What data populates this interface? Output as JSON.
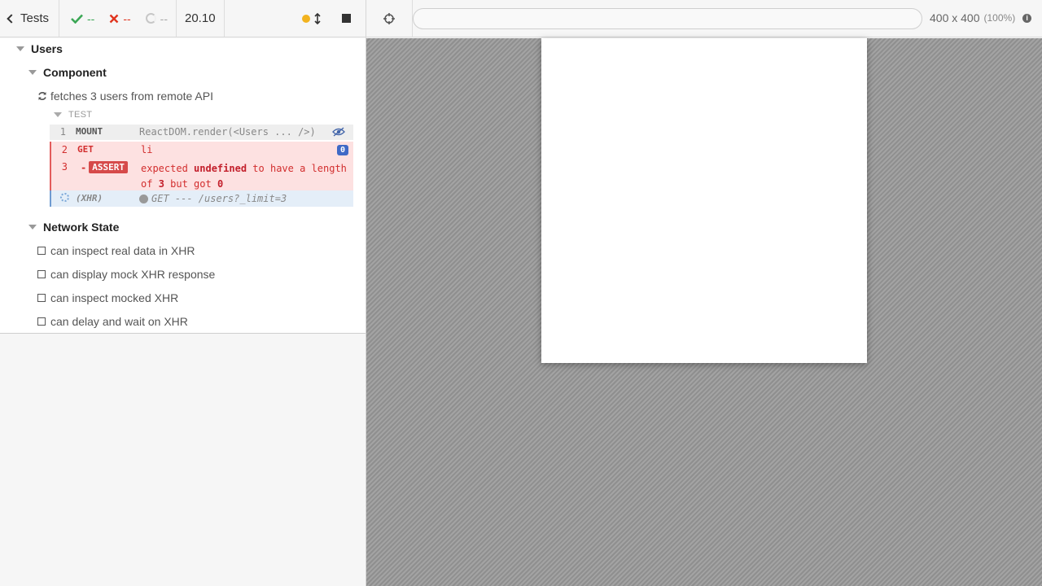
{
  "toolbar": {
    "tests_label": "Tests",
    "passed": "--",
    "failed": "--",
    "pending": "--",
    "duration": "20.10",
    "colors": {
      "pass": "#3ba755",
      "fail": "#e0341f",
      "running": "#f2b31f"
    }
  },
  "suites": {
    "users": "Users",
    "component": "Component",
    "network_state": "Network State"
  },
  "running_test": {
    "title": "fetches 3 users from remote API",
    "header": "TEST",
    "commands": [
      {
        "num": "1",
        "name": "MOUNT",
        "message": "ReactDOM.render(<Users ... />)"
      },
      {
        "num": "2",
        "name": "GET",
        "message": "li",
        "count": "0"
      },
      {
        "num": "3",
        "name": "ASSERT",
        "dash": "-",
        "msg_parts": [
          "expected",
          "undefined",
          "to have a length",
          "of",
          "3",
          "but got",
          "0"
        ]
      },
      {
        "num": "",
        "name": "(XHR)",
        "message": "GET --- /users?_limit=3"
      }
    ]
  },
  "network_tests": [
    "can inspect real data in XHR",
    "can display mock XHR response",
    "can inspect mocked XHR",
    "can delay and wait on XHR"
  ],
  "app_header": {
    "url": "",
    "viewport_size": "400 x 400",
    "viewport_scale": "(100%)"
  }
}
